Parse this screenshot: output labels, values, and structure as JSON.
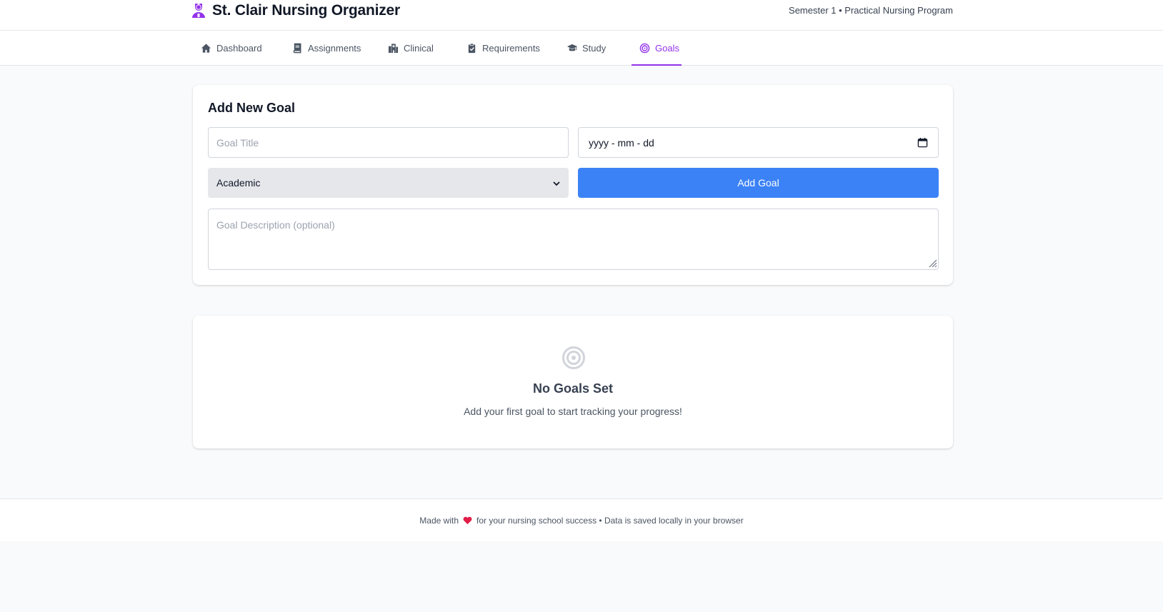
{
  "header": {
    "title": "St. Clair Nursing Organizer",
    "subtitle": "Semester 1 • Practical Nursing Program",
    "logo_icon": "nurse-icon",
    "accent_color": "#9333ea"
  },
  "nav": {
    "items": [
      {
        "label": "Dashboard",
        "icon": "home-icon",
        "active": false
      },
      {
        "label": "Assignments",
        "icon": "book-icon",
        "active": false
      },
      {
        "label": "Clinical",
        "icon": "hospital-icon",
        "active": false
      },
      {
        "label": "Requirements",
        "icon": "clipboard-check-icon",
        "active": false
      },
      {
        "label": "Study",
        "icon": "graduation-cap-icon",
        "active": false
      },
      {
        "label": "Goals",
        "icon": "target-icon",
        "active": true
      }
    ]
  },
  "form": {
    "title": "Add New Goal",
    "goal_title_placeholder": "Goal Title",
    "goal_title_value": "",
    "date_placeholder": "yyyy - mm - dd",
    "category_value": "Academic",
    "add_button_label": "Add Goal",
    "description_placeholder": "Goal Description (optional)",
    "button_color": "#3b82f6"
  },
  "empty_state": {
    "icon": "target-icon",
    "title": "No Goals Set",
    "message": "Add your first goal to start tracking your progress!"
  },
  "footer": {
    "made_with": "Made with",
    "heart_icon": "heart-icon",
    "text": "for your nursing school success • Data is saved locally in your browser"
  }
}
